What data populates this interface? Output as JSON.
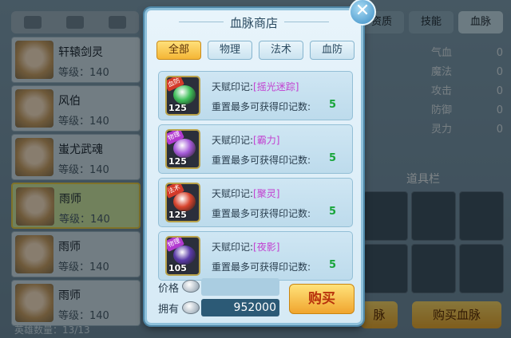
{
  "background": {
    "heroes": [
      {
        "name": "轩辕剑灵",
        "level": "等级：140"
      },
      {
        "name": "风伯",
        "level": "等级：140"
      },
      {
        "name": "蚩尤武魂",
        "level": "等级：140"
      },
      {
        "name": "雨师",
        "level": "等级：140"
      },
      {
        "name": "雨师",
        "level": "等级：140"
      },
      {
        "name": "雨师",
        "level": "等级：140"
      }
    ],
    "hero_count": "英雄数量：13/13",
    "right_tabs": [
      "资质",
      "技能",
      "血脉"
    ],
    "stats": [
      {
        "label": "气血",
        "value": "0"
      },
      {
        "label": "魔法",
        "value": "0"
      },
      {
        "label": "攻击",
        "value": "0"
      },
      {
        "label": "防御",
        "value": "0"
      },
      {
        "label": "灵力",
        "value": "0"
      }
    ],
    "bag_title": "道具栏",
    "bottom_left_label": "脉",
    "bottom_right_label": "购买血脉"
  },
  "shop": {
    "title": "血脉商店",
    "close_symbol": "✕",
    "tabs": [
      {
        "label": "全部",
        "active": true
      },
      {
        "label": "物理",
        "active": false
      },
      {
        "label": "法术",
        "active": false
      },
      {
        "label": "血防",
        "active": false
      }
    ],
    "items": [
      {
        "prefix": "天赋印记:",
        "name": "[摇光迷踪]",
        "desc": "重置最多可获得印记数:",
        "count": "5",
        "level": "125",
        "tag": "血防",
        "tag_color": "#d43a2a",
        "gem_color": "#3fbf5a"
      },
      {
        "prefix": "天赋印记:",
        "name": "[霸力]",
        "desc": "重置最多可获得印记数:",
        "count": "5",
        "level": "125",
        "tag": "物理",
        "tag_color": "#b23ad0",
        "gem_color": "#a55ad8"
      },
      {
        "prefix": "天赋印记:",
        "name": "[聚灵]",
        "desc": "重置最多可获得印记数:",
        "count": "5",
        "level": "125",
        "tag": "法术",
        "tag_color": "#d43a2a",
        "gem_color": "#d8442e"
      },
      {
        "prefix": "天赋印记:",
        "name": "[夜影]",
        "desc": "重置最多可获得印记数:",
        "count": "5",
        "level": "105",
        "tag": "物理",
        "tag_color": "#b23ad0",
        "gem_color": "#5a3aa8"
      }
    ],
    "price_label": "价格",
    "price_value": "",
    "own_label": "拥有",
    "own_value": "952000",
    "buy_label": "购买"
  }
}
